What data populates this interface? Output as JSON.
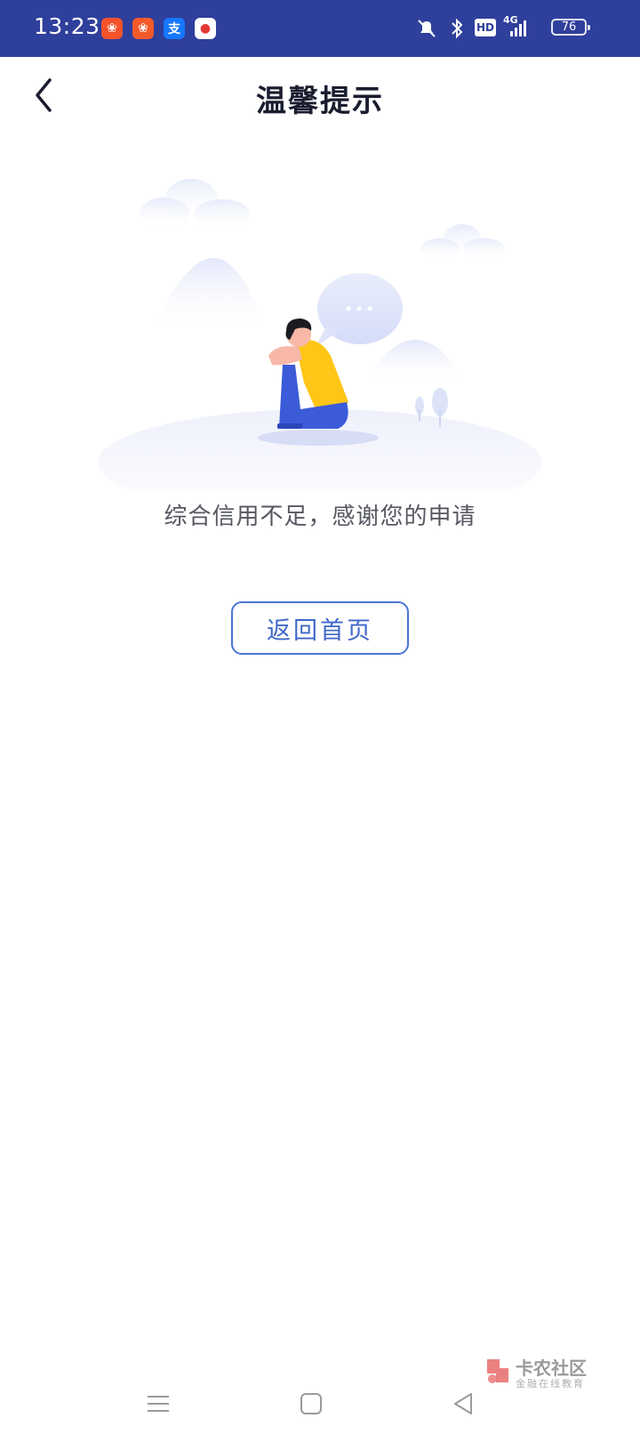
{
  "status_bar": {
    "time": "13:23",
    "apps": [
      {
        "icon": "kuaishou-icon",
        "glyph": "❀",
        "color": "#f4532b"
      },
      {
        "icon": "kuaishou-lite-icon",
        "glyph": "❀",
        "color": "#f45a2a"
      },
      {
        "icon": "alipay-icon",
        "glyph": "支",
        "color": "#1677ff"
      },
      {
        "icon": "map-pin-app-icon",
        "glyph": "●",
        "color": "#ffffff"
      }
    ],
    "network_label": "4G",
    "hd_label": "HD",
    "battery": "76"
  },
  "header": {
    "title": "温馨提示",
    "back_icon": "chevron-left-icon"
  },
  "content": {
    "message": "综合信用不足，感谢您的申请",
    "button_label": "返回首页"
  },
  "watermark": {
    "name": "卡农社区",
    "tagline": "金融在线教育"
  },
  "colors": {
    "status_bar": "#2f3f9c",
    "accent": "#4a74d8",
    "title": "#1a1d2e",
    "message": "#555761"
  }
}
